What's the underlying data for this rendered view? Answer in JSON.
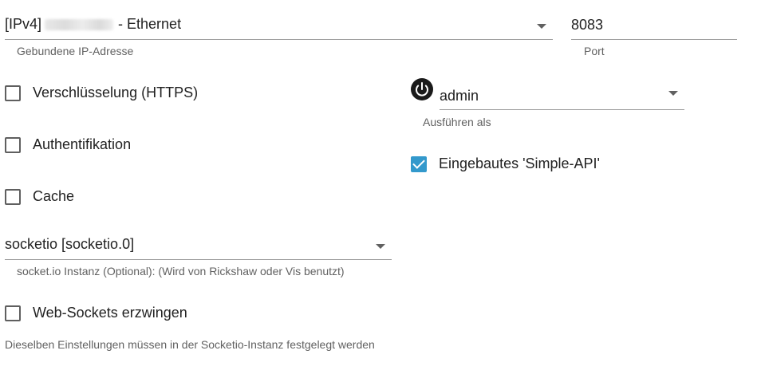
{
  "bind_ip": {
    "prefix": "[IPv4]",
    "suffix": "- Ethernet",
    "helper": "Gebundene IP-Adresse"
  },
  "port": {
    "value": "8083",
    "helper": "Port"
  },
  "run_as": {
    "value": "admin",
    "helper": "Ausführen als",
    "icon": "power-icon"
  },
  "checkboxes": {
    "https": {
      "label": "Verschlüsselung (HTTPS)",
      "checked": false
    },
    "auth": {
      "label": "Authentifikation",
      "checked": false
    },
    "cache": {
      "label": "Cache",
      "checked": false
    },
    "simple_api": {
      "label": "Eingebautes 'Simple-API'",
      "checked": true
    },
    "force_ws": {
      "label": "Web-Sockets erzwingen",
      "checked": false
    }
  },
  "socketio": {
    "value": "socketio [socketio.0]",
    "helper": "socket.io Instanz (Optional): (Wird von Rickshaw oder Vis benutzt)"
  },
  "note": "Dieselben Einstellungen müssen in der Socketio-Instanz festgelegt werden",
  "colors": {
    "accent": "#3399cc",
    "underline": "#9e9e9e",
    "helper_text": "#616161"
  }
}
